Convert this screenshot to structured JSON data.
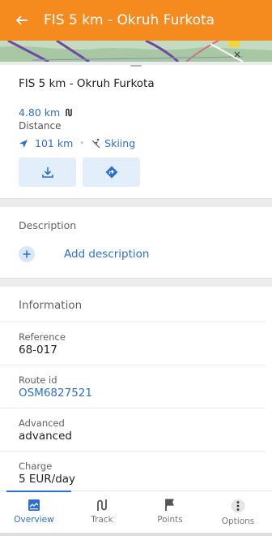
{
  "appbar": {
    "title": "FIS 5 km - Okruh Furkota",
    "back_icon": "arrow-left-icon"
  },
  "route": {
    "title": "FIS 5 km - Okruh Furkota",
    "distance": "4.80 km",
    "distance_label": "Distance",
    "direction_distance": "101 km",
    "separator": "•",
    "activity": "Skiing"
  },
  "description": {
    "title": "Description",
    "add_label": "Add description"
  },
  "information": {
    "title": "Information",
    "items": [
      {
        "key": "Reference",
        "value": "68-017"
      },
      {
        "key": "Route id",
        "value": "OSM6827521"
      },
      {
        "key": "Advanced",
        "value": "advanced"
      },
      {
        "key": "Charge",
        "value": "5 EUR/day"
      }
    ]
  },
  "tabs": [
    {
      "label": "Overview",
      "icon": "overview-icon"
    },
    {
      "label": "Track",
      "icon": "track-icon"
    },
    {
      "label": "Points",
      "icon": "flag-icon"
    },
    {
      "label": "Options",
      "icon": "more-vertical-icon"
    }
  ],
  "colors": {
    "accent": "#f58a1f",
    "link": "#2b6fd6"
  }
}
